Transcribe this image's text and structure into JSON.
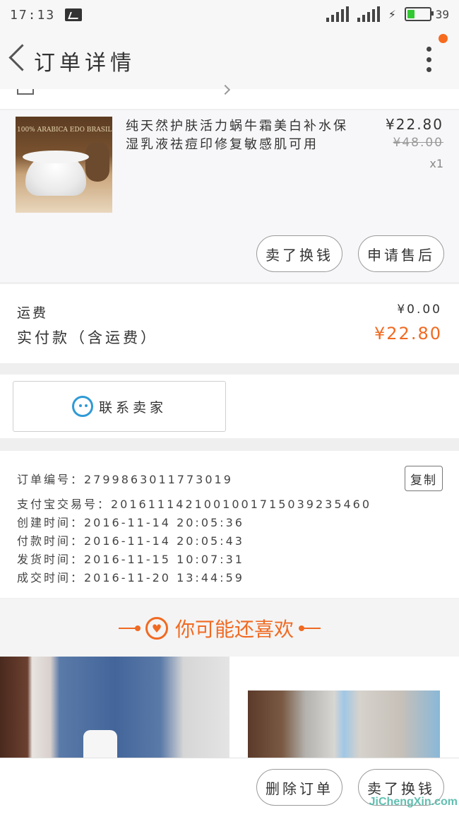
{
  "status_bar": {
    "time": "17:13",
    "battery_level": "39",
    "battery_fill": 0.39
  },
  "nav": {
    "title": "订单详情"
  },
  "product": {
    "name": "纯天然护肤活力蜗牛霜美白补水保湿乳液祛痘印修复敏感肌可用",
    "price": "¥22.80",
    "original_price": "¥48.00",
    "quantity": "x1",
    "image_label": "100% ARABICA EDO BRASIL",
    "buttons": {
      "sell": "卖了换钱",
      "after_sale": "申请售后"
    }
  },
  "fees": {
    "shipping_label": "运费",
    "shipping_value": "¥0.00",
    "paid_label": "实付款（含运费）",
    "paid_value": "¥22.80"
  },
  "contact": {
    "label": "联系卖家"
  },
  "order_info": {
    "copy_label": "复制",
    "lines": [
      "订单编号：2799863011773019",
      "支付宝交易号：2016111421001001715039235460",
      "创建时间：2016-11-14 20:05:36",
      "付款时间：2016-11-14 20:05:43",
      "发货时间：2016-11-15 10:07:31",
      "成交时间：2016-11-20 13:44:59"
    ]
  },
  "recommend": {
    "title": "你可能还喜欢"
  },
  "bottom_bar": {
    "delete_label": "删除订单",
    "sell_label": "卖了换钱"
  },
  "watermark": "JiChengXin.com",
  "colors": {
    "accent": "#f06a22",
    "chat": "#2f9ad6",
    "badge": "#f66b1e"
  }
}
